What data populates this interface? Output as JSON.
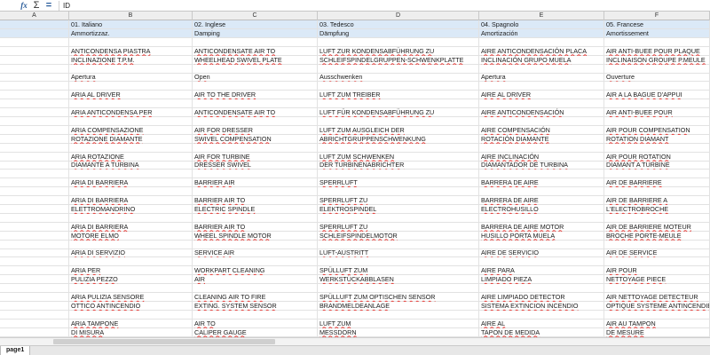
{
  "formula_bar": {
    "fx_icon": "fx-icon",
    "sum_symbol": "Σ",
    "equals_symbol": "=",
    "content": "ID"
  },
  "columns": [
    "A",
    "B",
    "C",
    "D",
    "E",
    "F"
  ],
  "rows": [
    {
      "a": "",
      "b": "01. Italiano",
      "c": "02. Inglese",
      "d": "03. Tedesco",
      "e": "04. Spagnolo",
      "f": "05. Francese",
      "hl": true
    },
    {
      "a": "",
      "b": "Ammortizzaz.",
      "c": "Damping",
      "d": "Dämpfung",
      "e": "Amortización",
      "f": "Amortissement",
      "hl": true
    },
    {
      "a": "",
      "b": "",
      "c": "",
      "d": "",
      "e": "",
      "f": ""
    },
    {
      "a": "",
      "b": "ANTICONDENSA PIASTRA",
      "c": "ANTICONDENSATE AIR TO",
      "d": "LUFT ZUR KONDENSABFÜHRUNG ZU",
      "e": "AIRE ANTICONDENSACIÓN PLACA",
      "f": "AIR ANTI-BUEE POUR PLAQUE"
    },
    {
      "a": "",
      "b": "INCLINAZIONE T.P.M.",
      "c": "WHEELHEAD SWIVEL PLATE",
      "d": "SCHLEIFSPINDELGRUPPEN-SCHWENKPLATTE",
      "e": "INCLINACIÓN GRUPO MUELA",
      "f": "INCLINAISON GROUPE P.MEULE"
    },
    {
      "a": "",
      "b": "",
      "c": "",
      "d": "",
      "e": "",
      "f": ""
    },
    {
      "a": "",
      "b": "Apertura",
      "c": "Open",
      "d": "Ausschwenken",
      "e": "Apertura",
      "f": "Ouverture"
    },
    {
      "a": "",
      "b": "",
      "c": "",
      "d": "",
      "e": "",
      "f": ""
    },
    {
      "a": "",
      "b": "ARIA AL DRIVER",
      "c": "AIR TO THE DRIVER",
      "d": "LUFT ZUM TREIBER",
      "e": "AIRE AL DRIVER",
      "f": "AIR A LA BAGUE D'APPUI"
    },
    {
      "a": "",
      "b": "",
      "c": "",
      "d": "",
      "e": "",
      "f": ""
    },
    {
      "a": "",
      "b": "ARIA ANTICONDENSA PER",
      "c": "ANTICONDENSATE AIR TO",
      "d": "LUFT FÜR KONDENSABFÜHRUNG ZU",
      "e": "AIRE ANTICONDENSACIÓN",
      "f": "AIR ANTI-BUEE POUR"
    },
    {
      "a": "",
      "b": "",
      "c": "",
      "d": "",
      "e": "",
      "f": ""
    },
    {
      "a": "",
      "b": "ARIA COMPENSAZIONE",
      "c": "AIR FOR DRESSER",
      "d": "LUFT ZUM AUSGLEICH DER",
      "e": "AIRE COMPENSACIÓN",
      "f": "AIR POUR COMPENSATION"
    },
    {
      "a": "",
      "b": "ROTAZIONE DIAMANTE",
      "c": "SWIVEL COMPENSATION",
      "d": "ABRICHTGRUPPENSCHWENKUNG",
      "e": "ROTACIÓN DIAMANTE",
      "f": "ROTATION DIAMANT"
    },
    {
      "a": "",
      "b": "",
      "c": "",
      "d": "",
      "e": "",
      "f": ""
    },
    {
      "a": "",
      "b": "ARIA ROTAZIONE",
      "c": "AIR FOR TURBINE",
      "d": "LUFT ZUM SCHWENKEN",
      "e": "AIRE INCLINACIÓN",
      "f": "AIR POUR ROTATION"
    },
    {
      "a": "",
      "b": "DIAMANTE A TURBINA",
      "c": "DRESSER SWIVEL",
      "d": "DER TURBINENABRICHTER",
      "e": "DIAMANTADOR DE TURBINA",
      "f": "DIAMANT A TURBINE"
    },
    {
      "a": "",
      "b": "",
      "c": "",
      "d": "",
      "e": "",
      "f": ""
    },
    {
      "a": "",
      "b": "ARIA DI BARRIERA",
      "c": "BARRIER AIR",
      "d": "SPERRLUFT",
      "e": "BARRERA DE AIRE",
      "f": "AIR DE BARRIERE"
    },
    {
      "a": "",
      "b": "",
      "c": "",
      "d": "",
      "e": "",
      "f": ""
    },
    {
      "a": "",
      "b": "ARIA DI BARRIERA",
      "c": "BARRIER AIR TO",
      "d": "SPERRLUFT ZU",
      "e": "BARRERA DE AIRE",
      "f": "AIR DE BARRIERE A"
    },
    {
      "a": "",
      "b": "ELETTROMANDRINO",
      "c": "ELECTRIC SPINDLE",
      "d": "ELEKTROSPINDEL",
      "e": "ELECTROHUSILLO",
      "f": "L'ELECTROBROCHE"
    },
    {
      "a": "",
      "b": "",
      "c": "",
      "d": "",
      "e": "",
      "f": ""
    },
    {
      "a": "",
      "b": "ARIA DI BARRIERA",
      "c": "BARRIER AIR TO",
      "d": "SPERRLUFT ZU",
      "e": "BARRERA DE AIRE MOTOR",
      "f": "AIR DE BARRIERE MOTEUR"
    },
    {
      "a": "",
      "b": "MOTORE ELMO",
      "c": "WHEEL SPINDLE MOTOR",
      "d": "SCHLEIFSPINDELMOTOR",
      "e": "HUSILLO PORTA MUELA",
      "f": "BROCHE PORTE-MEULE"
    },
    {
      "a": "",
      "b": "",
      "c": "",
      "d": "",
      "e": "",
      "f": ""
    },
    {
      "a": "",
      "b": "ARIA DI SERVIZIO",
      "c": "SERVICE AIR",
      "d": "LUFT-AUSTRITT",
      "e": "AIRE DE SERVICIO",
      "f": "AIR DE SERVICE"
    },
    {
      "a": "",
      "b": "",
      "c": "",
      "d": "",
      "e": "",
      "f": ""
    },
    {
      "a": "",
      "b": "ARIA PER",
      "c": "WORKPART CLEANING",
      "d": "SPÜLLUFT ZUM",
      "e": "AIRE PARA",
      "f": "AIR POUR"
    },
    {
      "a": "",
      "b": "PULIZIA PEZZO",
      "c": "AIR",
      "d": "WERKSTÜCKABBLASEN",
      "e": "LIMPIADO PIEZA",
      "f": "NETTOYAGE PIECE"
    },
    {
      "a": "",
      "b": "",
      "c": "",
      "d": "",
      "e": "",
      "f": ""
    },
    {
      "a": "",
      "b": "ARIA PULIZIA SENSORE",
      "c": "CLEANING AIR TO FIRE",
      "d": "SPÜLLUFT ZUM OPTISCHEN SENSOR",
      "e": "AIRE LIMPIADO DETECTOR",
      "f": "AIR NETTOYAGE DETECTEUR"
    },
    {
      "a": "",
      "b": "OTTICO ANTINCENDIO",
      "c": "EXTING. SYSTEM SENSOR",
      "d": "BRANDMELDEANLAGE",
      "e": "SISTEMA EXTINCION INCENDIO",
      "f": "OPTIQUE SYSTEME ANTINCENDIE"
    },
    {
      "a": "",
      "b": "",
      "c": "",
      "d": "",
      "e": "",
      "f": ""
    },
    {
      "a": "",
      "b": "ARIA TAMPONE",
      "c": "AIR TO",
      "d": "LUFT ZUM",
      "e": "AIRE AL",
      "f": "AIR AU TAMPON"
    },
    {
      "a": "",
      "b": "DI MISURA",
      "c": "CALIPER GAUGE",
      "d": "MESSDORN",
      "e": "TAPON DE MEDIDA",
      "f": "DE MESURE"
    }
  ],
  "sheet_tabs": [
    "page1"
  ]
}
